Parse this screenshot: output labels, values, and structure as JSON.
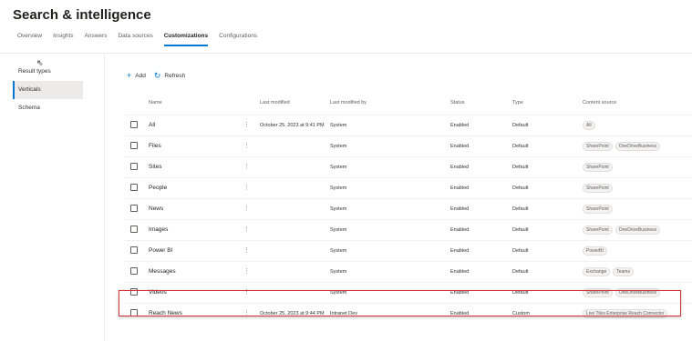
{
  "page": {
    "title": "Search & intelligence"
  },
  "tabs": [
    {
      "label": "Overview"
    },
    {
      "label": "Insights"
    },
    {
      "label": "Answers"
    },
    {
      "label": "Data sources"
    },
    {
      "label": "Customizations",
      "active": true
    },
    {
      "label": "Configurations"
    }
  ],
  "sidebar": {
    "items": [
      {
        "label": "Result types"
      },
      {
        "label": "Verticals",
        "active": true
      },
      {
        "label": "Schema"
      }
    ]
  },
  "toolbar": {
    "add_label": "Add",
    "refresh_label": "Refresh"
  },
  "table": {
    "columns": [
      "Name",
      "Last modified",
      "Last modified by",
      "Status",
      "Type",
      "Content source"
    ],
    "rows": [
      {
        "name": "All",
        "last_modified": "October 25, 2023 at 9:41 PM",
        "modified_by": "System",
        "status": "Enabled",
        "type": "Default",
        "sources": [
          "All"
        ]
      },
      {
        "name": "Files",
        "last_modified": "",
        "modified_by": "System",
        "status": "Enabled",
        "type": "Default",
        "sources": [
          "SharePoint",
          "OneDriveBusiness"
        ]
      },
      {
        "name": "Sites",
        "last_modified": "",
        "modified_by": "System",
        "status": "Enabled",
        "type": "Default",
        "sources": [
          "SharePoint"
        ]
      },
      {
        "name": "People",
        "last_modified": "",
        "modified_by": "System",
        "status": "Enabled",
        "type": "Default",
        "sources": [
          "SharePoint"
        ]
      },
      {
        "name": "News",
        "last_modified": "",
        "modified_by": "System",
        "status": "Enabled",
        "type": "Default",
        "sources": [
          "SharePoint"
        ]
      },
      {
        "name": "Images",
        "last_modified": "",
        "modified_by": "System",
        "status": "Enabled",
        "type": "Default",
        "sources": [
          "SharePoint",
          "OneDriveBusiness"
        ]
      },
      {
        "name": "Power BI",
        "last_modified": "",
        "modified_by": "System",
        "status": "Enabled",
        "type": "Default",
        "sources": [
          "PowerBI"
        ]
      },
      {
        "name": "Messages",
        "last_modified": "",
        "modified_by": "System",
        "status": "Enabled",
        "type": "Default",
        "sources": [
          "Exchange",
          "Teams"
        ]
      },
      {
        "name": "Videos",
        "last_modified": "",
        "modified_by": "System",
        "status": "Enabled",
        "type": "Default",
        "sources": [
          "SharePoint",
          "OneDriveBusiness"
        ]
      },
      {
        "name": "Reach News",
        "last_modified": "October 25, 2023 at 9:44 PM",
        "modified_by": "Intranet Dev",
        "status": "Enabled",
        "type": "Custom",
        "sources": [
          "Live Tiles Enterprise Reach Connector"
        ]
      }
    ]
  },
  "icons": {
    "add": "plus-icon",
    "refresh": "refresh-icon",
    "row_menu": "more-vertical-icon",
    "pointer": "mouse-cursor-icon"
  },
  "colors": {
    "accent": "#0078d4",
    "highlight": "#d13438"
  }
}
